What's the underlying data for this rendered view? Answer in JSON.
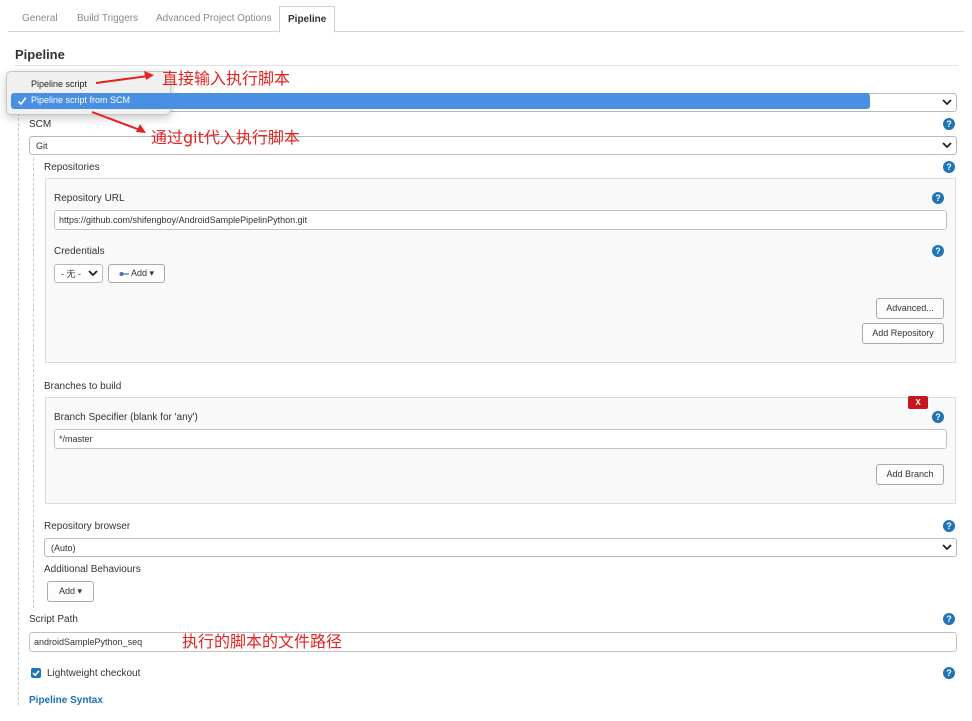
{
  "tabs": [
    {
      "label": "General"
    },
    {
      "label": "Build Triggers"
    },
    {
      "label": "Advanced Project Options"
    },
    {
      "label": "Pipeline"
    }
  ],
  "pipeline": {
    "section_title": "Pipeline",
    "definition_options": [
      "Pipeline script",
      "Pipeline script from SCM"
    ],
    "scm_label": "SCM",
    "scm_value": "Git",
    "repositories_label": "Repositories",
    "repo_url_label": "Repository URL",
    "repo_url_value": "https://github.com/shifengboy/AndroidSamplePipelinPython.git",
    "credentials_label": "Credentials",
    "credentials_value": "- 无 -",
    "add_label": "Add",
    "advanced_label": "Advanced...",
    "add_repository_label": "Add Repository",
    "branches_label": "Branches to build",
    "delete_label": "X",
    "branch_specifier_label": "Branch Specifier (blank for 'any')",
    "branch_specifier_value": "*/master",
    "add_branch_label": "Add Branch",
    "repo_browser_label": "Repository browser",
    "repo_browser_value": "(Auto)",
    "additional_behaviours_label": "Additional Behaviours",
    "add_behaviour_label": "Add",
    "script_path_label": "Script Path",
    "script_path_value": "androidSamplePython_seq",
    "lightweight_label": "Lightweight checkout",
    "lightweight_checked": true,
    "pipeline_syntax_label": "Pipeline Syntax",
    "help_glyph": "?"
  },
  "annotations": {
    "direct_script": "直接输入执行脚本",
    "git_script": "通过git代入执行脚本",
    "script_path_note": "执行的脚本的文件路径",
    "color": "#e32222"
  },
  "colors": {
    "help_icon": "#1f73b7",
    "selected_item": "#4a90e2",
    "delete_button": "#c8161d",
    "link": "#1f6fb2"
  }
}
